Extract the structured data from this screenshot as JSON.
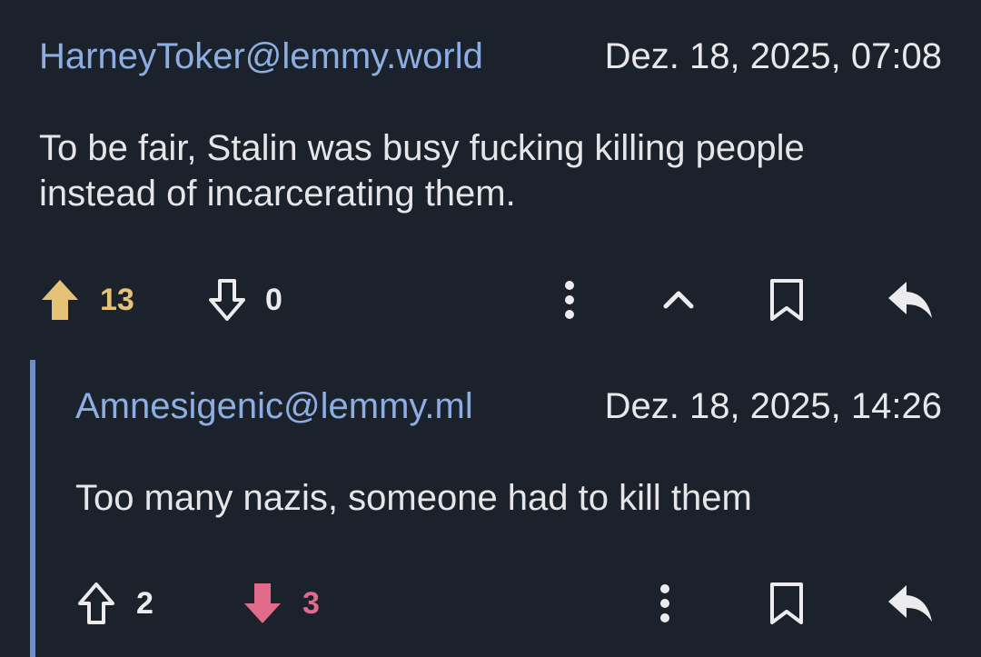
{
  "colors": {
    "background": "#1b222c",
    "username": "#8caee2",
    "text": "#e6e6e8",
    "upvote_active": "#e6c277",
    "downvote_active": "#e06b8a",
    "thread_line": "#6a8fc9"
  },
  "comments": [
    {
      "author": "HarneyToker@lemmy.world",
      "timestamp": "Dez. 18, 2025, 07:08",
      "text": "To be fair, Stalin was busy fucking killing people instead of incarcerating them.",
      "upvotes": "13",
      "downvotes": "0",
      "vote_state": "upvoted",
      "icons": [
        "arrow-up-filled-icon",
        "arrow-down-outline-icon",
        "more-vertical-icon",
        "chevron-up-icon",
        "bookmark-icon",
        "reply-icon"
      ]
    },
    {
      "author": "Amnesigenic@lemmy.ml",
      "timestamp": "Dez. 18, 2025, 14:26",
      "text": "Too many nazis, someone had to kill them",
      "upvotes": "2",
      "downvotes": "3",
      "vote_state": "downvoted",
      "icons": [
        "arrow-up-outline-icon",
        "arrow-down-filled-icon",
        "more-vertical-icon",
        "bookmark-icon",
        "reply-icon"
      ]
    }
  ]
}
